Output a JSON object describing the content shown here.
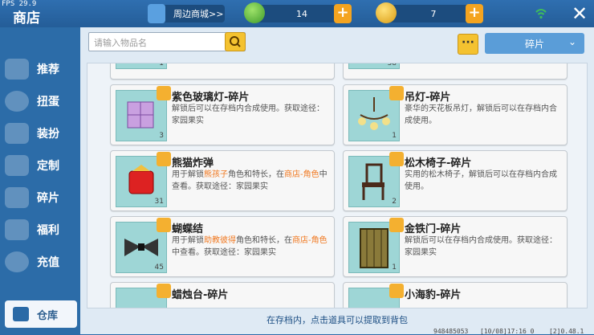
{
  "fps": "FPS 29.9",
  "title": "商店",
  "topbar": {
    "mall_label": "周边商城>>",
    "gem_count": "14",
    "coin_count": "7",
    "plus": "+",
    "close": "✕"
  },
  "sidebar": {
    "items": [
      {
        "label": "推荐",
        "icon": "thumb-up-icon"
      },
      {
        "label": "扭蛋",
        "icon": "capsule-icon"
      },
      {
        "label": "装扮",
        "icon": "shirt-icon"
      },
      {
        "label": "定制",
        "icon": "pen-icon"
      },
      {
        "label": "碎片",
        "icon": "puzzle-icon"
      },
      {
        "label": "福利",
        "icon": "gift-icon"
      },
      {
        "label": "充值",
        "icon": "coins-icon"
      }
    ],
    "warehouse": "仓库"
  },
  "search": {
    "placeholder": "请输入物品名"
  },
  "more": "···",
  "filter": {
    "selected": "碎片"
  },
  "top_row": [
    {
      "qty": "1"
    },
    {
      "qty": "38"
    }
  ],
  "cards": [
    {
      "name": "紫色玻璃灯-碎片",
      "desc": "解锁后可以在存档内合成使用。获取途径：家园果实",
      "qty": "3"
    },
    {
      "name": "吊灯-碎片",
      "desc": "豪华的天花板吊灯，解锁后可以在存档内合成使用。",
      "qty": "1"
    },
    {
      "name": "熊猫炸弹",
      "desc_pre": "用于解锁",
      "desc_hl": "熊孩子",
      "desc_mid": "角色和特长，在",
      "desc_hl2": "商店-角色",
      "desc_post": "中查看。获取途径：家园果实",
      "qty": "31"
    },
    {
      "name": "松木椅子-碎片",
      "desc": "实用的松木椅子，解锁后可以在存档内合成使用。",
      "qty": "2"
    },
    {
      "name": "蝴蝶结",
      "desc_pre": "用于解锁",
      "desc_hl": "助教彼得",
      "desc_mid": "角色和特长，在",
      "desc_hl2": "商店-角色",
      "desc_post": "中查看。获取途径：家园果实",
      "qty": "45"
    },
    {
      "name": "金铁门-碎片",
      "desc": "解锁后可以在存档内合成使用。获取途径：家园果实",
      "qty": "1"
    },
    {
      "name": "蜡烛台-碎片",
      "desc": "",
      "qty": ""
    },
    {
      "name": "小海豹-碎片",
      "desc": "",
      "qty": ""
    }
  ],
  "footer": {
    "hint": "在存档内，点击道具可以提取到背包",
    "id": "948485053",
    "time": "[10/08]17:16 0",
    "version": "[2]0.48.1"
  }
}
